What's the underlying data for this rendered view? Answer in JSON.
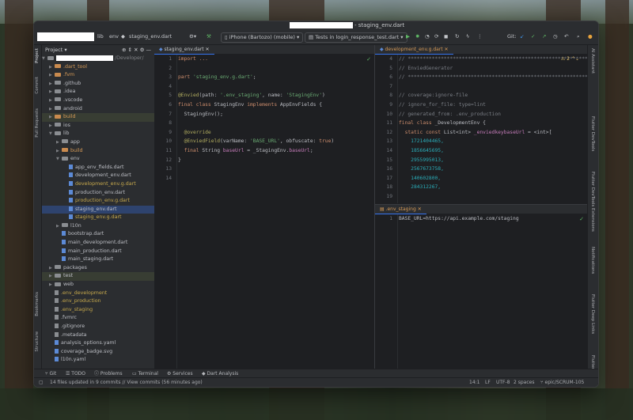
{
  "window": {
    "title": "- staging_env.dart"
  },
  "toolbar": {
    "breadcrumb_lib": "lib",
    "breadcrumb_env": "env",
    "breadcrumb_file": "staging_env.dart",
    "device": "iPhone (Bartozo) (mobile)",
    "run_config": "Tests in login_response_test.dart",
    "git_label": "Git:"
  },
  "left_stripe": {
    "project": "Project",
    "commit": "Commit",
    "pull_requests": "Pull Requests",
    "bookmarks": "Bookmarks",
    "structure": "Structure"
  },
  "right_stripe": {
    "ai": "AI Assistant",
    "devtools": "Flutter DevTools",
    "devtools_ext": "Flutter DevTools Extensions",
    "notifications": "Notifications",
    "deeplinks": "Flutter Deep Links",
    "inspector": "Flutter Inspec"
  },
  "project": {
    "header": "Project",
    "root_suffix": "/Developer/",
    "items": [
      {
        "label": ".dart_tool",
        "depth": 1,
        "kind": "folder",
        "style": "orange"
      },
      {
        "label": ".fvm",
        "depth": 1,
        "kind": "folder",
        "style": "orange"
      },
      {
        "label": ".github",
        "depth": 1,
        "kind": "folder",
        "style": ""
      },
      {
        "label": ".idea",
        "depth": 1,
        "kind": "folder",
        "style": ""
      },
      {
        "label": ".vscode",
        "depth": 1,
        "kind": "folder",
        "style": ""
      },
      {
        "label": "android",
        "depth": 1,
        "kind": "folder",
        "style": ""
      },
      {
        "label": "build",
        "depth": 1,
        "kind": "folder",
        "style": "orange",
        "hl": true
      },
      {
        "label": "ios",
        "depth": 1,
        "kind": "folder",
        "style": ""
      },
      {
        "label": "lib",
        "depth": 1,
        "kind": "folder",
        "style": "",
        "open": true
      },
      {
        "label": "app",
        "depth": 2,
        "kind": "folder",
        "style": ""
      },
      {
        "label": "build",
        "depth": 2,
        "kind": "folder",
        "style": "orange"
      },
      {
        "label": "env",
        "depth": 2,
        "kind": "folder",
        "style": "",
        "open": true
      },
      {
        "label": "app_env_fields.dart",
        "depth": 3,
        "kind": "file",
        "style": ""
      },
      {
        "label": "development_env.dart",
        "depth": 3,
        "kind": "file",
        "style": ""
      },
      {
        "label": "development_env.g.dart",
        "depth": 3,
        "kind": "file",
        "style": "yellowish"
      },
      {
        "label": "production_env.dart",
        "depth": 3,
        "kind": "file",
        "style": ""
      },
      {
        "label": "production_env.g.dart",
        "depth": 3,
        "kind": "file",
        "style": "yellowish"
      },
      {
        "label": "staging_env.dart",
        "depth": 3,
        "kind": "file",
        "style": "",
        "sel": true
      },
      {
        "label": "staging_env.g.dart",
        "depth": 3,
        "kind": "file",
        "style": "yellowish"
      },
      {
        "label": "l10n",
        "depth": 2,
        "kind": "folder",
        "style": ""
      },
      {
        "label": "bootstrap.dart",
        "depth": 2,
        "kind": "file",
        "style": ""
      },
      {
        "label": "main_development.dart",
        "depth": 2,
        "kind": "file",
        "style": ""
      },
      {
        "label": "main_production.dart",
        "depth": 2,
        "kind": "file",
        "style": ""
      },
      {
        "label": "main_staging.dart",
        "depth": 2,
        "kind": "file",
        "style": ""
      },
      {
        "label": "packages",
        "depth": 1,
        "kind": "folder",
        "style": ""
      },
      {
        "label": "test",
        "depth": 1,
        "kind": "folder",
        "style": "",
        "hl": true
      },
      {
        "label": "web",
        "depth": 1,
        "kind": "folder",
        "style": ""
      },
      {
        "label": ".env_development",
        "depth": 1,
        "kind": "file",
        "style": "yellowish"
      },
      {
        "label": ".env_production",
        "depth": 1,
        "kind": "file",
        "style": "yellowish"
      },
      {
        "label": ".env_staging",
        "depth": 1,
        "kind": "file",
        "style": "yellowish"
      },
      {
        "label": ".fvmrc",
        "depth": 1,
        "kind": "file",
        "style": ""
      },
      {
        "label": ".gitignore",
        "depth": 1,
        "kind": "file",
        "style": ""
      },
      {
        "label": ".metadata",
        "depth": 1,
        "kind": "file",
        "style": ""
      },
      {
        "label": "analysis_options.yaml",
        "depth": 1,
        "kind": "file",
        "style": ""
      },
      {
        "label": "coverage_badge.svg",
        "depth": 1,
        "kind": "file",
        "style": ""
      },
      {
        "label": "l10n.yaml",
        "depth": 1,
        "kind": "file",
        "style": ""
      }
    ]
  },
  "editor_left": {
    "tab": "staging_env.dart",
    "line_numbers": [
      "1",
      "2",
      "3",
      "4",
      "5",
      "6",
      "7",
      "8",
      "9",
      "10",
      "11",
      "12",
      "13",
      "14"
    ],
    "lines": [
      [
        {
          "t": "import ...",
          "c": "k"
        }
      ],
      [],
      [
        {
          "t": "part ",
          "c": "k"
        },
        {
          "t": "'staging_env.g.dart'",
          "c": "s"
        },
        {
          "t": ";",
          "c": ""
        }
      ],
      [],
      [
        {
          "t": "@Envied",
          "c": "a"
        },
        {
          "t": "(path: ",
          "c": ""
        },
        {
          "t": "'.env_staging'",
          "c": "s"
        },
        {
          "t": ", name: ",
          "c": ""
        },
        {
          "t": "'StagingEnv'",
          "c": "s"
        },
        {
          "t": ")",
          "c": ""
        }
      ],
      [
        {
          "t": "final class ",
          "c": "k"
        },
        {
          "t": "StagingEnv ",
          "c": ""
        },
        {
          "t": "implements ",
          "c": "k"
        },
        {
          "t": "AppEnvFields {",
          "c": ""
        }
      ],
      [
        {
          "t": "  StagingEnv();",
          "c": ""
        }
      ],
      [],
      [
        {
          "t": "  @override",
          "c": "a"
        }
      ],
      [
        {
          "t": "  @EnviedField",
          "c": "a"
        },
        {
          "t": "(varName: ",
          "c": ""
        },
        {
          "t": "'BASE_URL'",
          "c": "s"
        },
        {
          "t": ", obfuscate: ",
          "c": ""
        },
        {
          "t": "true",
          "c": "k"
        },
        {
          "t": ")",
          "c": ""
        }
      ],
      [
        {
          "t": "  final ",
          "c": "k"
        },
        {
          "t": "String ",
          "c": ""
        },
        {
          "t": "baseUrl",
          "c": "p"
        },
        {
          "t": " = _StagingEnv.",
          "c": ""
        },
        {
          "t": "baseUrl",
          "c": "p"
        },
        {
          "t": ";",
          "c": ""
        }
      ],
      [
        {
          "t": "}",
          "c": ""
        }
      ],
      [],
      []
    ]
  },
  "editor_right_top": {
    "tab": "development_env.g.dart",
    "warning_count": "2",
    "line_numbers": [
      "4",
      "5",
      "6",
      "7",
      "8",
      "9",
      "10",
      "11",
      "12",
      "13",
      "14",
      "15",
      "16",
      "17",
      "18",
      "19"
    ],
    "lines": [
      [
        {
          "t": "// ***************************************************************",
          "c": "c"
        }
      ],
      [
        {
          "t": "// EnviedGenerator",
          "c": "c"
        }
      ],
      [
        {
          "t": "// ***************************************************************",
          "c": "c"
        }
      ],
      [],
      [
        {
          "t": "// coverage:ignore-file",
          "c": "c"
        }
      ],
      [
        {
          "t": "// ignore_for_file: type=lint",
          "c": "c"
        }
      ],
      [
        {
          "t": "// generated_from: .env_production",
          "c": "c"
        }
      ],
      [
        {
          "t": "final class ",
          "c": "k"
        },
        {
          "t": "_DevelopmentEnv {",
          "c": ""
        }
      ],
      [
        {
          "t": "  static const ",
          "c": "k"
        },
        {
          "t": "List<int> ",
          "c": ""
        },
        {
          "t": "_enviedkeybaseUrl",
          "c": "p"
        },
        {
          "t": " = <int>[",
          "c": ""
        }
      ],
      [
        {
          "t": "    1721404465,",
          "c": "n"
        }
      ],
      [
        {
          "t": "    1856645695,",
          "c": "n"
        }
      ],
      [
        {
          "t": "    2955995013,",
          "c": "n"
        }
      ],
      [
        {
          "t": "    2567673758,",
          "c": "n"
        }
      ],
      [
        {
          "t": "    140602800,",
          "c": "n"
        }
      ],
      [
        {
          "t": "    284312267,",
          "c": "n"
        }
      ],
      []
    ]
  },
  "editor_right_bot": {
    "tab": ".env_staging",
    "line_numbers": [
      "1"
    ],
    "lines": [
      [
        {
          "t": "BASE_URL=https://api.example.com/staging",
          "c": ""
        }
      ]
    ]
  },
  "bottom_tools": {
    "git": "Git",
    "todo": "TODO",
    "problems": "Problems",
    "terminal": "Terminal",
    "services": "Services",
    "dart_analysis": "Dart Analysis"
  },
  "status": {
    "message": "14 files updated in 9 commits // View commits (56 minutes ago)",
    "position": "14:1",
    "line_sep": "LF",
    "encoding": "UTF-8",
    "indent": "2 spaces",
    "branch": "epic/SCRUM-105"
  }
}
